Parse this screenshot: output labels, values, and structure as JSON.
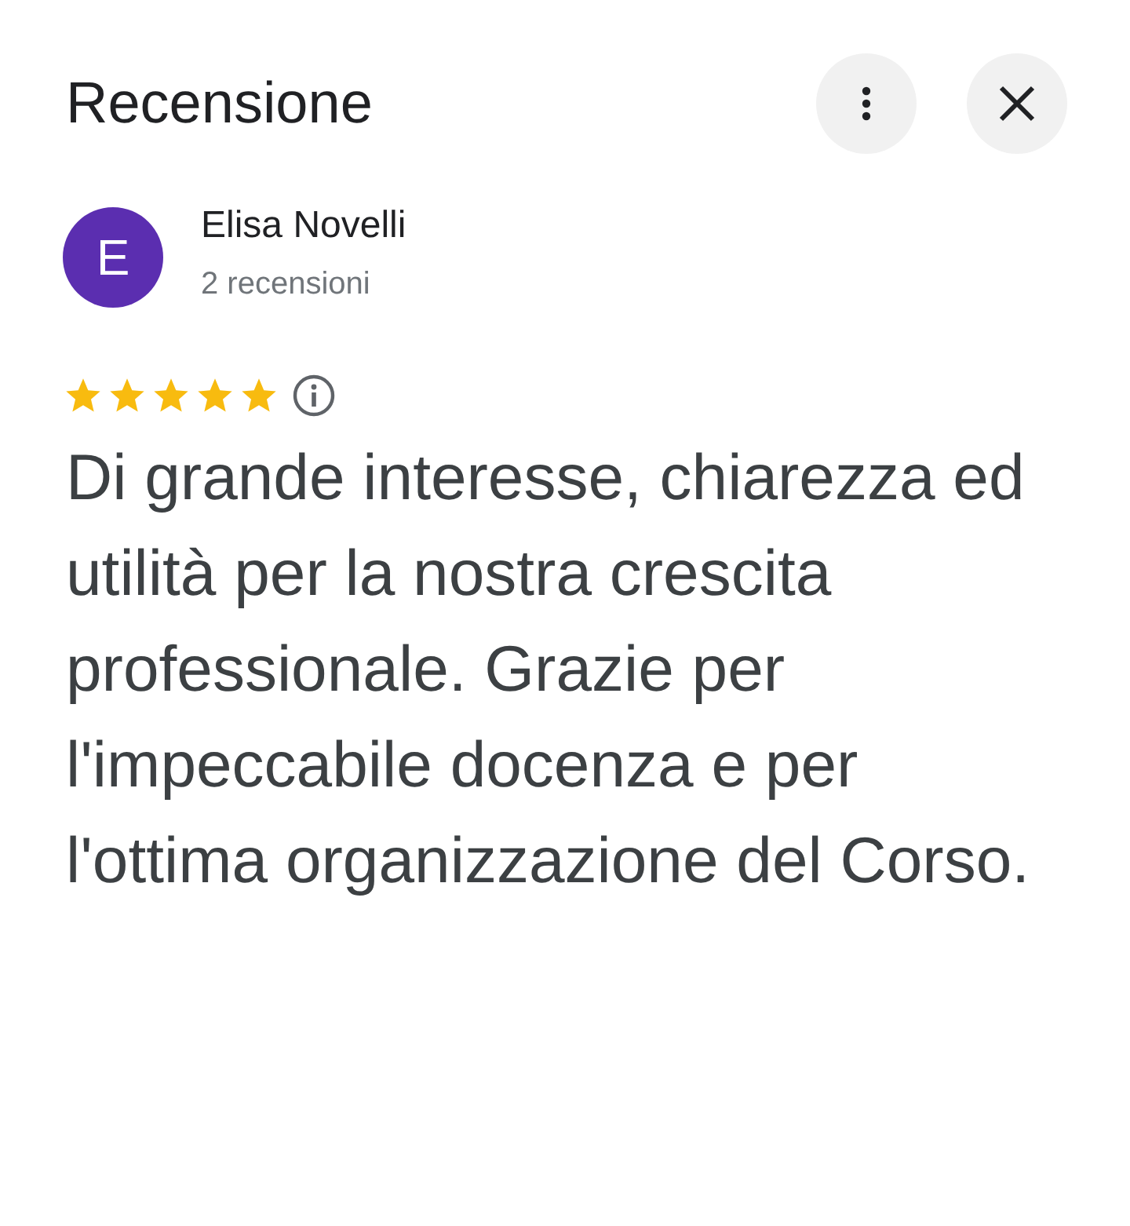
{
  "header": {
    "title": "Recensione"
  },
  "reviewer": {
    "initial": "E",
    "color": "#5b2eb0",
    "name": "Elisa Novelli",
    "review_count": "2 recensioni"
  },
  "rating": {
    "stars": 5
  },
  "review_text": "Di grande interesse, chiarezza ed utilità per la nostra crescita professionale. Grazie per l'impeccabile docenza e per l'ottima organizzazione del Corso."
}
